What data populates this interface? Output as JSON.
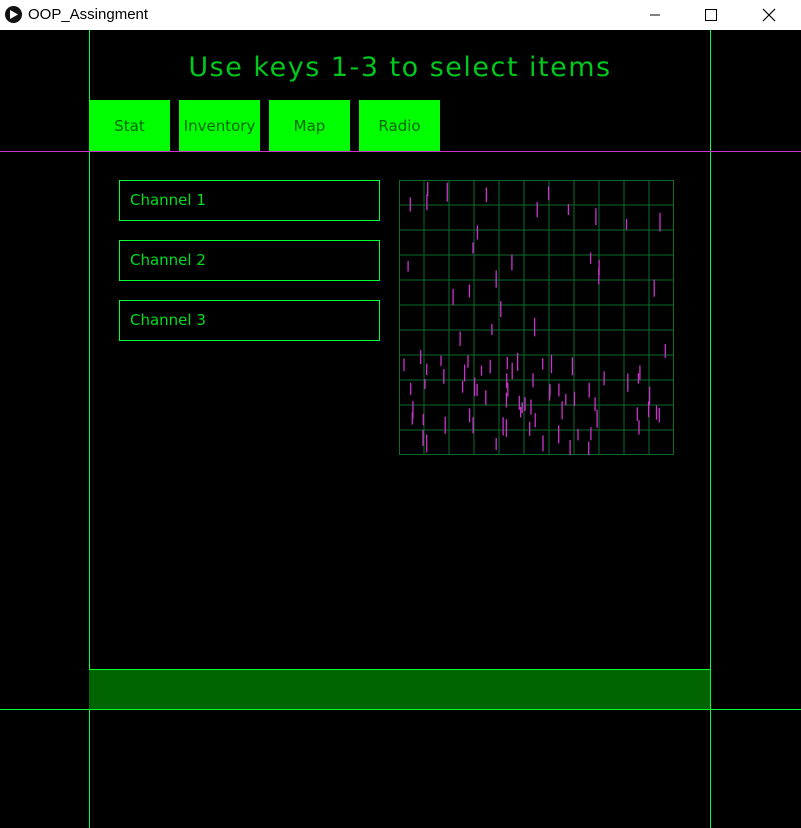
{
  "window": {
    "title": "OOP_Assingment",
    "minimize_icon": "minimize-icon",
    "maximize_icon": "maximize-icon",
    "close_icon": "close-icon"
  },
  "heading": "Use keys 1-3 to select items",
  "tabs": [
    {
      "label": "Stat"
    },
    {
      "label": "Inventory"
    },
    {
      "label": "Map"
    },
    {
      "label": "Radio"
    }
  ],
  "channels": [
    {
      "label": "Channel 1"
    },
    {
      "label": "Channel 2"
    },
    {
      "label": "Channel 3"
    }
  ],
  "colors": {
    "accent": "#00ff00",
    "text_green": "#00dd22",
    "grid_line": "#0a6b2a",
    "signal": "#cc33cc",
    "divider_magenta": "#cc33cc",
    "bottom_bar": "#006400"
  },
  "radar": {
    "grid_cells": 11
  }
}
